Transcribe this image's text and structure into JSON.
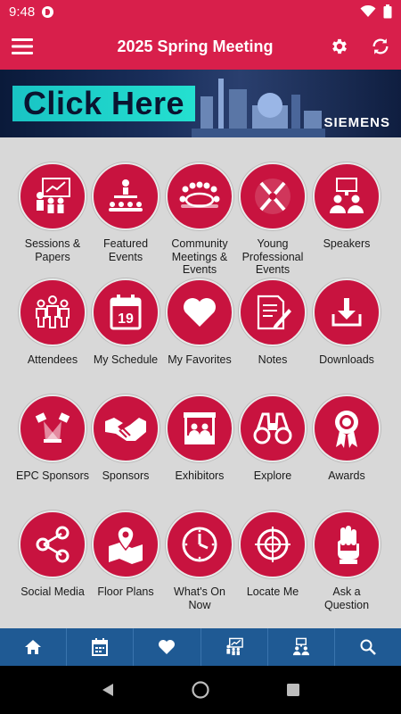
{
  "status": {
    "time": "9:48"
  },
  "app_bar": {
    "title": "2025 Spring Meeting"
  },
  "banner": {
    "cta": "Click Here",
    "brand": "SIEMENS"
  },
  "tiles": [
    {
      "label": "Sessions & Papers",
      "icon": "presentation-icon"
    },
    {
      "label": "Featured Events",
      "icon": "featured-events-icon"
    },
    {
      "label": "Community Meetings & Events",
      "icon": "community-icon"
    },
    {
      "label": "Young Professional Events",
      "icon": "young-professional-icon"
    },
    {
      "label": "Speakers",
      "icon": "speakers-icon"
    },
    {
      "label": "Attendees",
      "icon": "attendees-icon"
    },
    {
      "label": "My Schedule",
      "icon": "calendar-icon",
      "day": "19"
    },
    {
      "label": "My Favorites",
      "icon": "heart-icon"
    },
    {
      "label": "Notes",
      "icon": "notes-icon"
    },
    {
      "label": "Downloads",
      "icon": "download-icon"
    },
    {
      "label": "EPC Sponsors",
      "icon": "spotlight-icon"
    },
    {
      "label": "Sponsors",
      "icon": "handshake-icon"
    },
    {
      "label": "Exhibitors",
      "icon": "booth-icon"
    },
    {
      "label": "Explore",
      "icon": "binoculars-icon"
    },
    {
      "label": "Awards",
      "icon": "award-ribbon-icon"
    },
    {
      "label": "Social Media",
      "icon": "share-icon"
    },
    {
      "label": "Floor Plans",
      "icon": "map-pin-icon"
    },
    {
      "label": "What's On Now",
      "icon": "clock-icon"
    },
    {
      "label": "Locate Me",
      "icon": "target-icon"
    },
    {
      "label": "Ask a Question",
      "icon": "raised-hand-icon"
    }
  ],
  "bottom_nav": [
    {
      "icon": "home-icon"
    },
    {
      "icon": "calendar-icon"
    },
    {
      "icon": "heart-icon"
    },
    {
      "icon": "presentation-icon"
    },
    {
      "icon": "speakers-icon"
    },
    {
      "icon": "search-icon"
    }
  ],
  "colors": {
    "primary": "#d81f4b",
    "tile": "#c8133f",
    "nav": "#1f5a94"
  }
}
